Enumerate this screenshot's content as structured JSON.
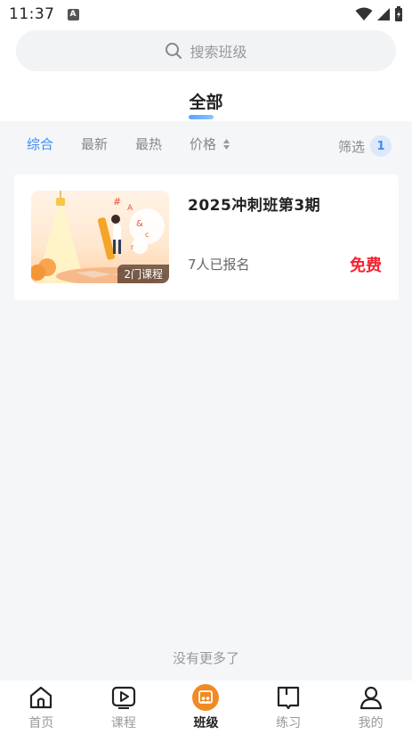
{
  "status_bar": {
    "time": "11:37",
    "notif_letter": "A"
  },
  "search": {
    "placeholder": "搜索班级"
  },
  "tab_header": {
    "label": "全部"
  },
  "filters": {
    "items": [
      "综合",
      "最新",
      "最热",
      "价格"
    ],
    "active_index": 0,
    "screen_label": "筛选",
    "screen_count": "1"
  },
  "class_card": {
    "title": "2025冲刺班第3期",
    "course_badge": "2门课程",
    "enrolled": "7人已报名",
    "price": "免费"
  },
  "list_footer": "没有更多了",
  "tabbar": {
    "items": [
      {
        "label": "首页",
        "icon": "home-icon"
      },
      {
        "label": "课程",
        "icon": "course-play-icon"
      },
      {
        "label": "班级",
        "icon": "class-icon"
      },
      {
        "label": "练习",
        "icon": "practice-book-icon"
      },
      {
        "label": "我的",
        "icon": "profile-icon"
      }
    ],
    "active_index": 2
  },
  "colors": {
    "accent": "#3d8af7",
    "price": "#f5222d",
    "tab_active": "#f08a24"
  }
}
